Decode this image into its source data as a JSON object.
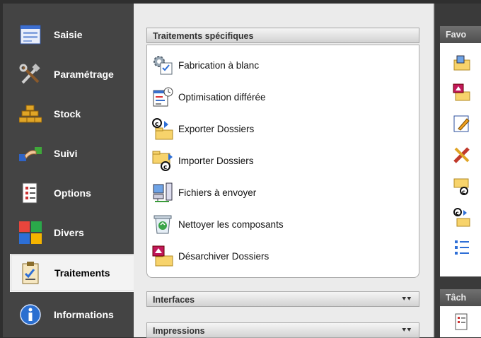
{
  "nav": {
    "items": [
      {
        "label": "Saisie",
        "icon": "form-icon"
      },
      {
        "label": "Paramétrage",
        "icon": "tools-icon"
      },
      {
        "label": "Stock",
        "icon": "gold-bars-icon"
      },
      {
        "label": "Suivi",
        "icon": "handshake-icon"
      },
      {
        "label": "Options",
        "icon": "checklist-icon"
      },
      {
        "label": "Divers",
        "icon": "colored-squares-icon"
      },
      {
        "label": "Traitements",
        "icon": "clipboard-check-icon",
        "active": true
      },
      {
        "label": "Informations",
        "icon": "info-icon"
      }
    ]
  },
  "main": {
    "section_title": "Traitements spécifiques",
    "items": [
      {
        "label": "Fabrication à blanc",
        "icon": "gear-checklist-icon"
      },
      {
        "label": "Optimisation différée",
        "icon": "schedule-icon"
      },
      {
        "label": "Exporter Dossiers",
        "icon": "export-folder-icon"
      },
      {
        "label": "Importer Dossiers",
        "icon": "import-folder-icon"
      },
      {
        "label": "Fichiers à envoyer",
        "icon": "server-icon"
      },
      {
        "label": "Nettoyer les composants",
        "icon": "recycle-bin-icon"
      },
      {
        "label": "Désarchiver Dossiers",
        "icon": "unarchive-folder-icon"
      }
    ],
    "collapsed_sections": [
      {
        "title": "Interfaces"
      },
      {
        "title": "Impressions"
      }
    ]
  },
  "right_panel": {
    "favorites_title": "Favo",
    "tasks_title": "Tâch"
  },
  "colors": {
    "nav_bg": "#444444",
    "main_bg": "#ebebeb",
    "active_item_bg": "#f3f3f3"
  }
}
